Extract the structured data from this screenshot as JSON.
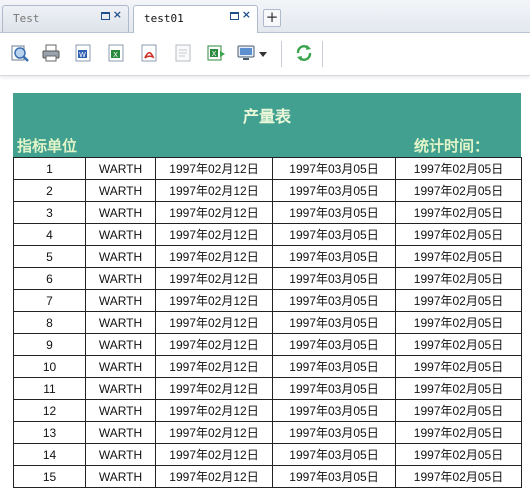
{
  "tabs": [
    {
      "label": "Test",
      "active": false
    },
    {
      "label": "test01",
      "active": true
    }
  ],
  "tab_controls": {
    "restore": "restore-icon",
    "close": "×",
    "new_tab": "+"
  },
  "toolbar": {
    "icons": [
      "print-preview-icon",
      "print-icon",
      "export-word-icon",
      "export-excel-icon",
      "export-pdf-icon",
      "export-text-icon",
      "export-excel-alt-icon",
      "display-mode-icon",
      "dropdown-arrow-icon",
      "refresh-icon"
    ]
  },
  "colors": {
    "banner": "#41a090",
    "banner_text": "#e2f5c9"
  },
  "report": {
    "title": "产量表",
    "unit_label": "指标单位",
    "stat_label": "统计时间：",
    "rows": [
      [
        "1",
        "WARTH",
        "1997年02月12日",
        "1997年03月05日",
        "1997年02月05日"
      ],
      [
        "2",
        "WARTH",
        "1997年02月12日",
        "1997年03月05日",
        "1997年02月05日"
      ],
      [
        "3",
        "WARTH",
        "1997年02月12日",
        "1997年03月05日",
        "1997年02月05日"
      ],
      [
        "4",
        "WARTH",
        "1997年02月12日",
        "1997年03月05日",
        "1997年02月05日"
      ],
      [
        "5",
        "WARTH",
        "1997年02月12日",
        "1997年03月05日",
        "1997年02月05日"
      ],
      [
        "6",
        "WARTH",
        "1997年02月12日",
        "1997年03月05日",
        "1997年02月05日"
      ],
      [
        "7",
        "WARTH",
        "1997年02月12日",
        "1997年03月05日",
        "1997年02月05日"
      ],
      [
        "8",
        "WARTH",
        "1997年02月12日",
        "1997年03月05日",
        "1997年02月05日"
      ],
      [
        "9",
        "WARTH",
        "1997年02月12日",
        "1997年03月05日",
        "1997年02月05日"
      ],
      [
        "10",
        "WARTH",
        "1997年02月12日",
        "1997年03月05日",
        "1997年02月05日"
      ],
      [
        "11",
        "WARTH",
        "1997年02月12日",
        "1997年03月05日",
        "1997年02月05日"
      ],
      [
        "12",
        "WARTH",
        "1997年02月12日",
        "1997年03月05日",
        "1997年02月05日"
      ],
      [
        "13",
        "WARTH",
        "1997年02月12日",
        "1997年03月05日",
        "1997年02月05日"
      ],
      [
        "14",
        "WARTH",
        "1997年02月12日",
        "1997年03月05日",
        "1997年02月05日"
      ],
      [
        "15",
        "WARTH",
        "1997年02月12日",
        "1997年03月05日",
        "1997年02月05日"
      ]
    ]
  }
}
